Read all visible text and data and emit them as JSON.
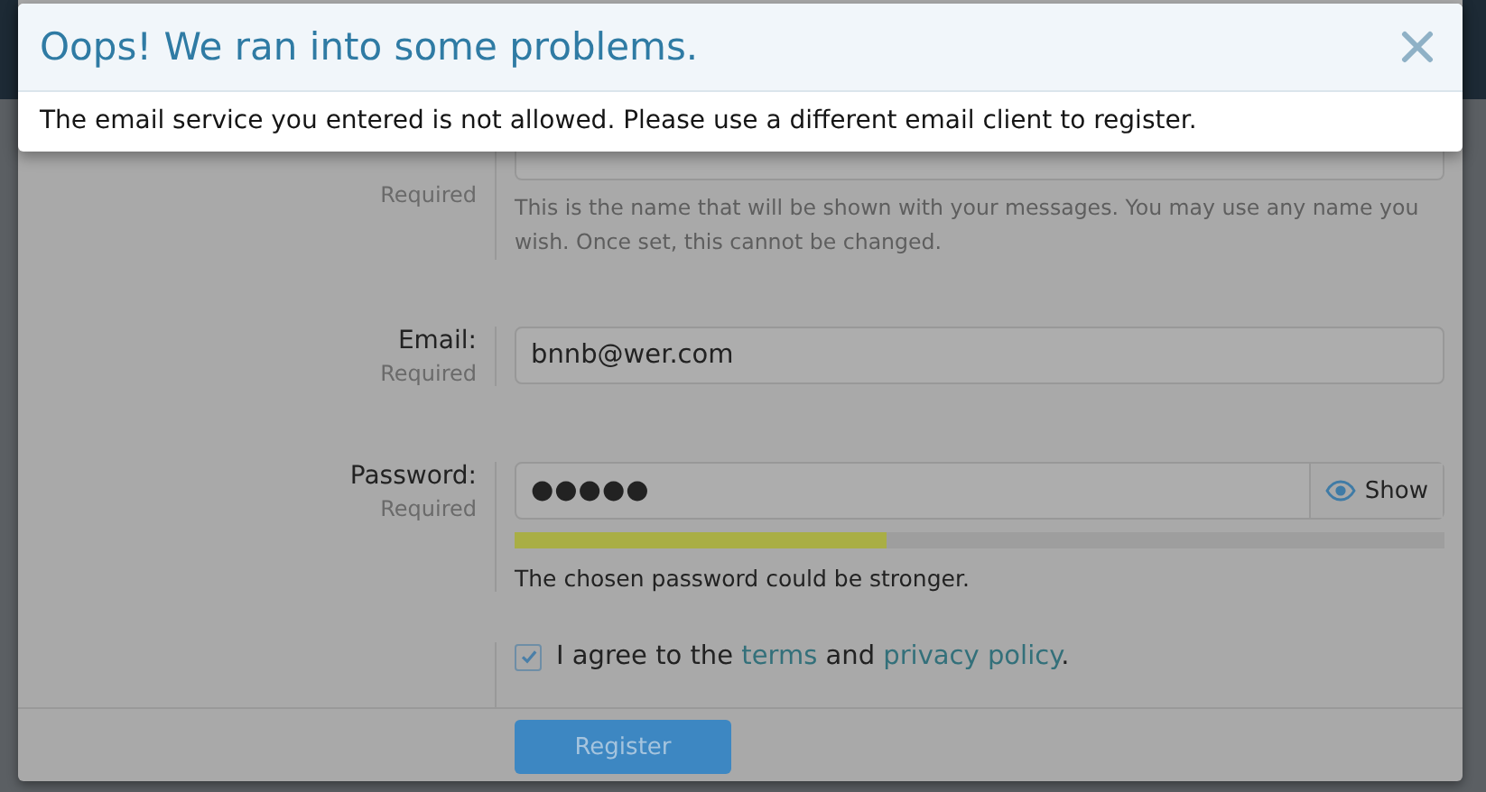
{
  "error_dialog": {
    "title": "Oops! We ran into some problems.",
    "message": "The email service you entered is not allowed. Please use a different email client to register."
  },
  "register_form": {
    "fields": [
      {
        "kind": "text",
        "required": "Required",
        "hint": "This is the name that will be shown with your messages. You may use any name you wish. Once set, this cannot be changed."
      },
      {
        "kind": "text",
        "label": "Email:",
        "required": "Required",
        "value": "bnnb@wer.com"
      },
      {
        "kind": "password",
        "label": "Password:",
        "required": "Required",
        "value": "●●●●●",
        "show_button": "Show",
        "strength": {
          "level": 0.4,
          "text": "The chosen password could be stronger."
        }
      }
    ],
    "agreement": {
      "checked": true,
      "parts": [
        {
          "kind": "text",
          "text": "I agree to the "
        },
        {
          "kind": "link",
          "text": "terms"
        },
        {
          "kind": "text",
          "text": " and "
        },
        {
          "kind": "link",
          "text": "privacy policy"
        },
        {
          "kind": "text",
          "text": "."
        }
      ]
    },
    "submit_button": "Register"
  }
}
